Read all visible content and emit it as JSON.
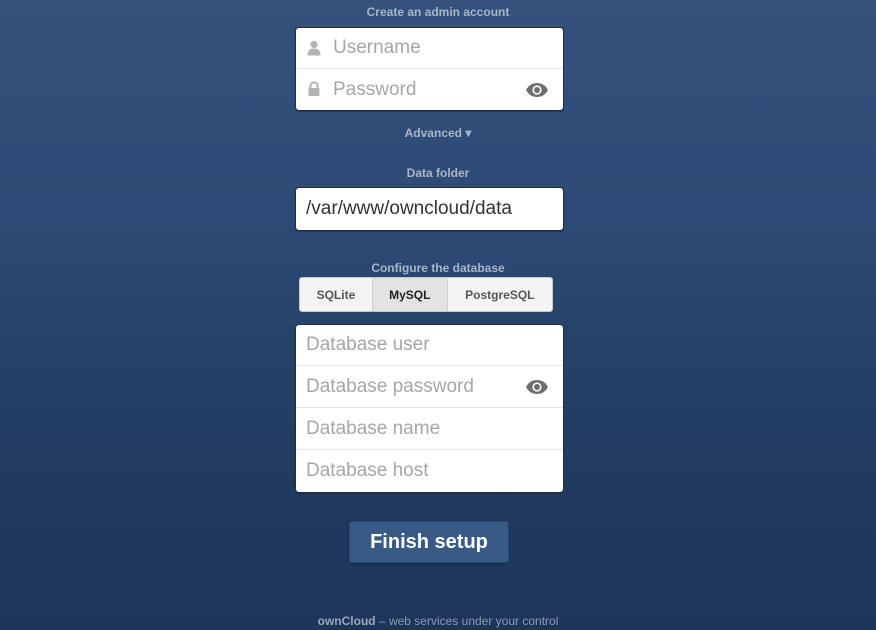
{
  "admin": {
    "heading": "Create an admin account",
    "username_placeholder": "Username",
    "password_placeholder": "Password",
    "advanced_label": "Advanced ▾"
  },
  "data_folder": {
    "label": "Data folder",
    "value": "/var/www/owncloud/data"
  },
  "database": {
    "heading": "Configure the database",
    "tabs": [
      {
        "label": "SQLite",
        "active": false
      },
      {
        "label": "MySQL",
        "active": true
      },
      {
        "label": "PostgreSQL",
        "active": false
      }
    ],
    "user_placeholder": "Database user",
    "password_placeholder": "Database password",
    "name_placeholder": "Database name",
    "host_placeholder": "Database host"
  },
  "finish_label": "Finish setup",
  "footer": {
    "brand": "ownCloud",
    "tagline": " – web services under your control"
  },
  "icons": {
    "username": "user-icon",
    "password": "lock-icon",
    "show_password": "eye-icon"
  },
  "colors": {
    "background": "#2c4a75",
    "button": "#3a5a86",
    "label": "#a9b6c8"
  }
}
